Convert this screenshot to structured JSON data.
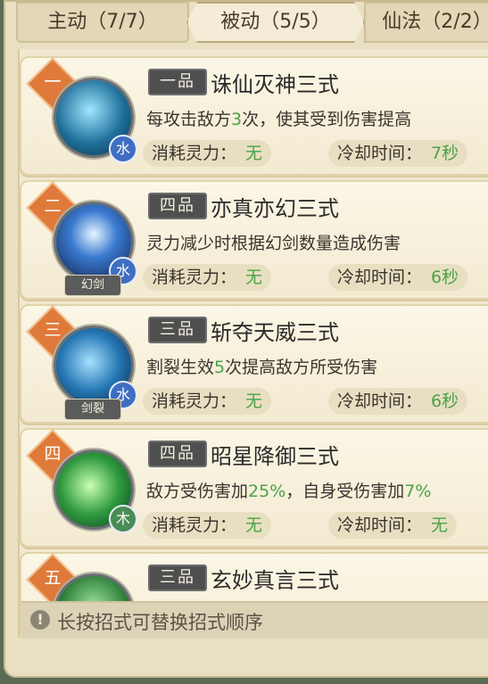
{
  "tabs": [
    {
      "label": "主动（7/7）"
    },
    {
      "label": "被动（5/5）"
    },
    {
      "label": "仙法（2/2）"
    }
  ],
  "skills": [
    {
      "rank": "一",
      "grade": "一品",
      "name": "诛仙灭神三式",
      "element": "水",
      "tag": "",
      "desc_parts": [
        "每攻击敌方",
        "3",
        "次，使其受到伤害提高"
      ],
      "cost_label": "消耗灵力：",
      "cost_value": "无",
      "cooldown_label": "冷却时间：",
      "cooldown_value": "7秒"
    },
    {
      "rank": "二",
      "grade": "四品",
      "name": "亦真亦幻三式",
      "element": "水",
      "tag": "幻剑",
      "desc_parts": [
        "灵力减少时根据幻剑数量造成伤害",
        "",
        ""
      ],
      "cost_label": "消耗灵力：",
      "cost_value": "无",
      "cooldown_label": "冷却时间：",
      "cooldown_value": "6秒"
    },
    {
      "rank": "三",
      "grade": "三品",
      "name": "斩夺天威三式",
      "element": "水",
      "tag": "剑裂",
      "desc_parts": [
        "割裂生效",
        "5",
        "次提高敌方所受伤害"
      ],
      "cost_label": "消耗灵力：",
      "cost_value": "无",
      "cooldown_label": "冷却时间：",
      "cooldown_value": "6秒"
    },
    {
      "rank": "四",
      "grade": "四品",
      "name": "昭星降御三式",
      "element": "木",
      "tag": "",
      "desc_parts": [
        "敌方受伤害加",
        "25%",
        "，自身受伤害加",
        "7%"
      ],
      "cost_label": "消耗灵力：",
      "cost_value": "无",
      "cooldown_label": "冷却时间：",
      "cooldown_value": "无"
    },
    {
      "rank": "五",
      "grade": "三品",
      "name": "玄妙真言三式",
      "element": "",
      "tag": "",
      "desc_parts": [
        "",
        "",
        ""
      ],
      "cost_label": "",
      "cost_value": "",
      "cooldown_label": "",
      "cooldown_value": ""
    }
  ],
  "tip": {
    "icon": "info-icon",
    "text": "长按招式可替换招式顺序"
  },
  "colors": {
    "accent_green": "#4aa347",
    "rank_orange": "#e07a3a",
    "water_blue": "#3f6ec1",
    "wood_green": "#4a8c55"
  }
}
